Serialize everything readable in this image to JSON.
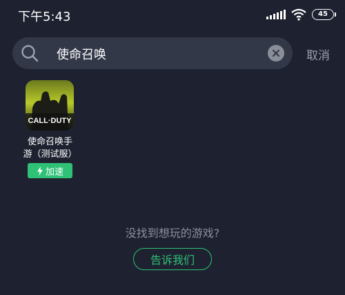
{
  "status_bar": {
    "time": "下午5:43",
    "battery": "45"
  },
  "search": {
    "value": "使命召唤",
    "cancel_label": "取消"
  },
  "results": [
    {
      "icon_text": "CALL·DUTY",
      "name_line1": "使命召唤手",
      "name_line2": "游（测试服）",
      "action_label": "加速"
    }
  ],
  "empty_hint": {
    "text": "没找到想玩的游戏?",
    "button_label": "告诉我们"
  },
  "colors": {
    "background": "#1e2230",
    "search_bg": "#333849",
    "accent": "#2fc176",
    "muted_text": "#8a8f9c"
  }
}
